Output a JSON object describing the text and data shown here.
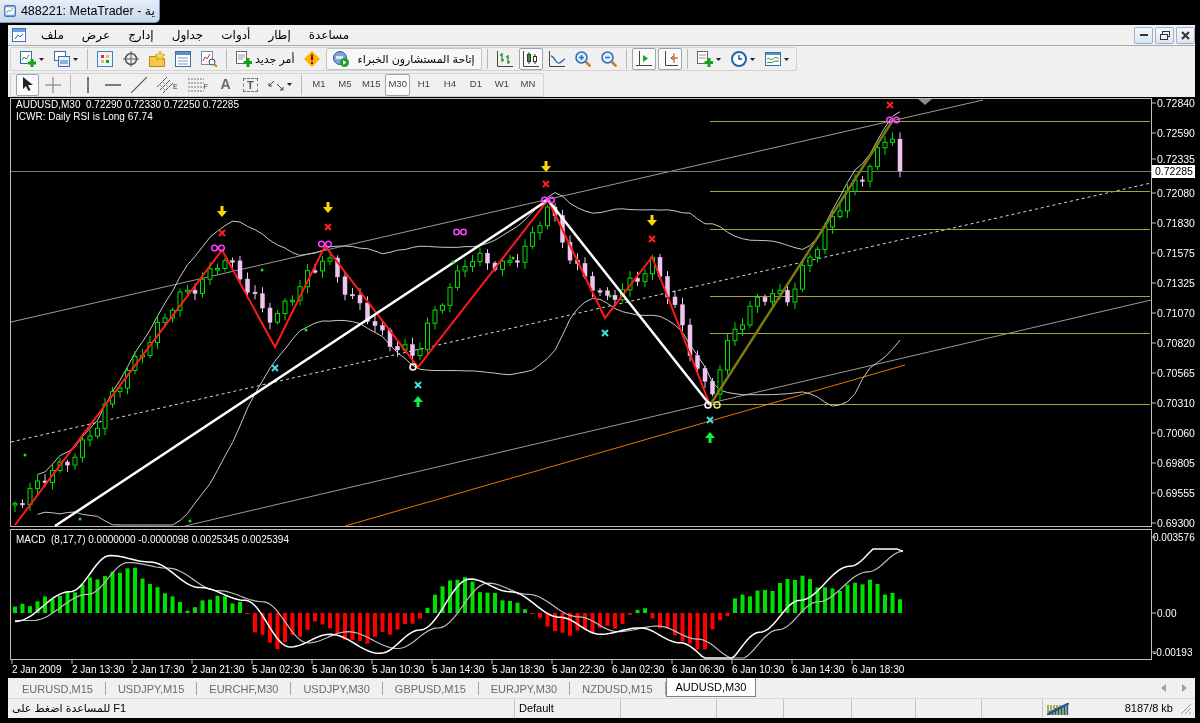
{
  "window": {
    "title": "488221: MetaTrader - ية"
  },
  "menu": [
    "مساعدة",
    "إطار",
    "أدوات",
    "جداول",
    "إدارج",
    "عرض",
    "ملف"
  ],
  "toolbar": {
    "new_order": "أمر جديد",
    "auto_trading": "إتاحة المستشارون الخبراء",
    "chart_types": [
      {
        "kind": "bars",
        "selected": false
      },
      {
        "kind": "candles",
        "selected": true
      },
      {
        "kind": "line",
        "selected": false
      }
    ],
    "chart_shift": {
      "on": true
    },
    "auto_scroll": {
      "on": true
    }
  },
  "tools": [
    {
      "kind": "cursor",
      "selected": true
    },
    {
      "kind": "crosshair",
      "selected": false
    }
  ],
  "draw_tools": [
    {
      "kind": "vline"
    },
    {
      "kind": "hline"
    },
    {
      "kind": "trendline"
    },
    {
      "kind": "channel",
      "glyph": "E"
    },
    {
      "kind": "fibo",
      "glyph": "F"
    },
    {
      "kind": "text",
      "glyph": "A"
    },
    {
      "kind": "label",
      "glyph": "T"
    },
    {
      "kind": "arrows"
    }
  ],
  "periods": [
    {
      "label": "M1",
      "selected": false
    },
    {
      "label": "M5",
      "selected": false
    },
    {
      "label": "M15",
      "selected": false
    },
    {
      "label": "M30",
      "selected": true
    },
    {
      "label": "H1",
      "selected": false
    },
    {
      "label": "H4",
      "selected": false
    },
    {
      "label": "D1",
      "selected": false
    },
    {
      "label": "W1",
      "selected": false
    },
    {
      "label": "MN",
      "selected": false
    }
  ],
  "chart": {
    "legend": "AUDUSD,M30  0.72290 0.72330 0.72250 0.72285",
    "indicator_note": "ICWR: Daily RSI is Long 67.74",
    "price_ticks": [
      "0.72840",
      "0.72590",
      "0.72335",
      "0.72080",
      "0.71830",
      "0.71575",
      "0.71325",
      "0.71070",
      "0.70820",
      "0.70565",
      "0.70310",
      "0.70060",
      "0.69805",
      "0.69555",
      "0.69300"
    ],
    "current_price": "0.72285",
    "macd_legend": "MACD  (8,17,7) 0.0000000 -0.0000098 0.0025345 0.0025394",
    "macd_ticks": [
      "0.003576",
      "0.00",
      "-0.00193"
    ],
    "time_ticks": [
      "2 Jan 2009",
      "2 Jan 13:30",
      "2 Jan 17:30",
      "2 Jan 21:30",
      "5 Jan 02:30",
      "5 Jan 06:30",
      "5 Jan 10:30",
      "5 Jan 14:30",
      "5 Jan 18:30",
      "5 Jan 22:30",
      "6 Jan 02:30",
      "6 Jan 06:30",
      "6 Jan 10:30",
      "6 Jan 14:30",
      "6 Jan 18:30"
    ]
  },
  "tabs": [
    {
      "label": "EURUSD,M15",
      "selected": false
    },
    {
      "label": "USDJPY,M15",
      "selected": false
    },
    {
      "label": "EURCHF,M30",
      "selected": false
    },
    {
      "label": "USDJPY,M30",
      "selected": false
    },
    {
      "label": "GBPUSD,M15",
      "selected": false
    },
    {
      "label": "EURJPY,M30",
      "selected": false
    },
    {
      "label": "NZDUSD,M15",
      "selected": false
    },
    {
      "label": "AUDUSD,M30",
      "selected": true
    }
  ],
  "status_bar": {
    "help": "للمساعدة اضغط على F1",
    "profile": "Default",
    "traffic": "8187/8 kb"
  }
}
